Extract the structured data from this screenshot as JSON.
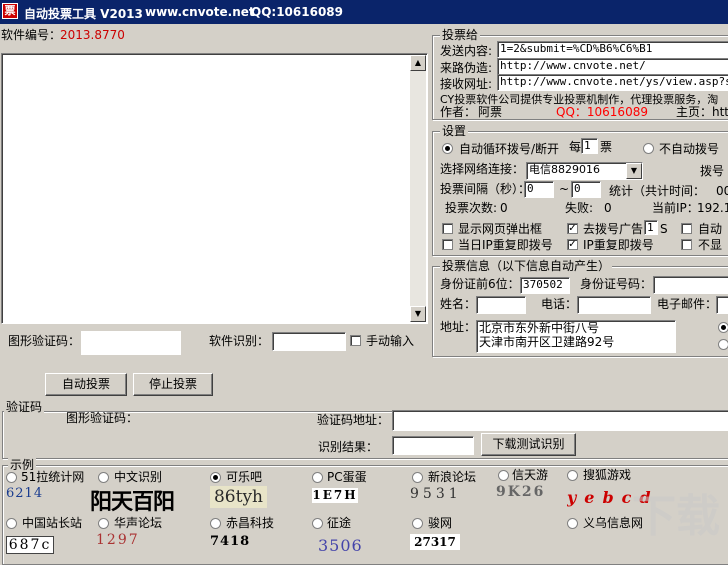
{
  "window": {
    "app_name": "自动投票工具 V2013",
    "website": "www.cnvote.net",
    "qq": "QQ:10616089"
  },
  "serial": {
    "label": "软件编号：",
    "value": "2013.8770"
  },
  "captcha_row": {
    "image_label": "图形验证码：",
    "software_recog_label": "软件识别：",
    "manual_input_label": "手动输入"
  },
  "buttons": {
    "auto_vote": "自动投票",
    "stop_vote": "停止投票"
  },
  "vote_group": {
    "title": "投票给",
    "send_content_label": "发送内容:",
    "send_content_value": "1=2&submit=%CD%B6%C6%B1",
    "referer_label": "来路伪造:",
    "referer_value": "http://www.cnvote.net/",
    "receive_url_label": "接收网址:",
    "receive_url_value": "http://www.cnvote.net/ys/view.asp?sid=",
    "promo": "CY投票软件公司提供专业投票机制作，代理投票服务，淘",
    "author_label": "作者：",
    "author_value": "阿票",
    "qq": "QQ：10616089",
    "homepage_label": "主页：",
    "homepage_value": "htt"
  },
  "settings_group": {
    "title": "设置",
    "auto_dial_label": "自动循环拨号/断开",
    "every_label": "每",
    "every_value": "1",
    "votes_unit": "票",
    "no_auto_dial_label": "不自动拨号",
    "network_label": "选择网络连接：",
    "network_value": "电信8829016",
    "dial_label": "拨号",
    "interval_label": "投票间隔（秒）：",
    "interval_from": "0",
    "interval_tilde": "~",
    "interval_to": "0",
    "stats_label": "统计（共计时间：",
    "stats_value": "00",
    "vote_count_label": "投票次数:",
    "vote_count_value": "0",
    "fail_label": "失败:",
    "fail_value": "0",
    "current_ip_label": "当前IP：",
    "current_ip_value": "192.1",
    "cb_show_popup": "显示网页弹出框",
    "cb_remove_ads": "去拨号广告",
    "ads_seconds": "1",
    "ads_unit": "S",
    "cb_auto_right": "自动",
    "cb_same_day_ip": "当日IP重复即拨号",
    "cb_ip_repeat": "IP重复即拨号",
    "cb_no_right": "不显"
  },
  "info_group": {
    "title": "投票信息（以下信息自动产生）",
    "id_first6_label": "身份证前6位：",
    "id_first6_value": "370502",
    "id_number_label": "身份证号码：",
    "name_label": "姓名：",
    "phone_label": "电话：",
    "email_label": "电子邮件：",
    "address_label": "地址：",
    "address_lines": [
      "北京市东外新中街八号",
      "天津市南开区卫建路92号"
    ]
  },
  "captcha_group": {
    "title": "验证码",
    "image_label": "图形验证码：",
    "url_label": "验证码地址：",
    "result_label": "识别结果：",
    "download_button": "下载测试识别"
  },
  "examples_group": {
    "title": "示例",
    "items": [
      {
        "label": "51拉统计网",
        "captcha": "6214",
        "selected": false
      },
      {
        "label": "中文识别",
        "captcha": "阳天百阳",
        "selected": false
      },
      {
        "label": "可乐吧",
        "captcha": "86tyh",
        "selected": true
      },
      {
        "label": "PC蛋蛋",
        "captcha": "1E7H",
        "selected": false
      },
      {
        "label": "新浪论坛",
        "captcha": "9531",
        "selected": false
      },
      {
        "label": "信天游",
        "captcha": "9K26",
        "selected": false
      },
      {
        "label": "搜狐游戏",
        "captcha": "yebcd",
        "selected": false
      },
      {
        "label": "中国站长站",
        "captcha": "687c",
        "selected": false
      },
      {
        "label": "华声论坛",
        "captcha": "1297",
        "selected": false
      },
      {
        "label": "赤昌科技",
        "captcha": "7418",
        "selected": false
      },
      {
        "label": "征途",
        "captcha": "3506",
        "selected": false
      },
      {
        "label": "骏网",
        "captcha": "27317",
        "selected": false
      },
      {
        "label": "义乌信息网",
        "captcha": "",
        "selected": false
      }
    ]
  },
  "colors": {
    "titlebar": "#0a246a",
    "serial_value": "#cc0000",
    "qq_red": "#ff0000"
  },
  "watermark": "下载"
}
